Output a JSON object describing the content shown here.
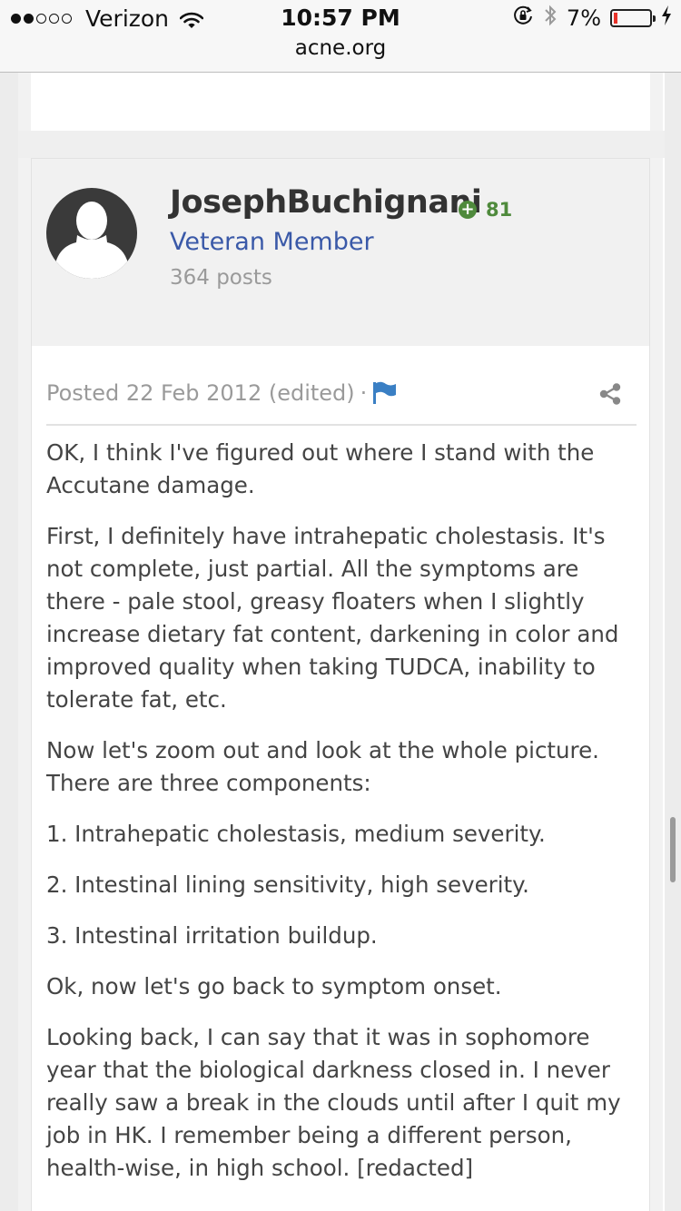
{
  "status_bar": {
    "carrier": "Verizon",
    "time": "10:57 PM",
    "battery": "7%",
    "signal_filled": 2,
    "signal_total": 5
  },
  "browser": {
    "url": "acne.org"
  },
  "post": {
    "author": "JosephBuchignani",
    "reputation": "81",
    "member_title": "Veteran Member",
    "post_count": "364 posts",
    "posted": "Posted 22 Feb 2012 (edited)",
    "meta_separator": "·",
    "paragraphs": [
      "OK, I think I've figured out where I stand with the Accutane damage.",
      "First, I definitely have intrahepatic cholestasis. It's not complete, just partial. All the symptoms are there - pale stool, greasy floaters when I slightly increase dietary fat content, darkening in color and improved quality when taking TUDCA, inability to tolerate fat, etc.",
      "Now let's zoom out and look at the whole picture. There are three components:",
      "1. Intrahepatic cholestasis, medium severity.",
      "2. Intestinal lining sensitivity, high severity.",
      "3. Intestinal irritation buildup.",
      "Ok, now let's go back to symptom onset.",
      "Looking back, I can say that it was in sophomore year that the biological darkness closed in. I never really saw a break in the clouds until after I quit my job in HK. I remember being a different person, health-wise, in high school. [redacted]"
    ]
  },
  "colors": {
    "member_title": "#3a59a8",
    "reputation": "#4f8a3c",
    "flag": "#3a7fc4",
    "battery_low": "#e8332a"
  },
  "icons": {
    "wifi": "wifi-icon",
    "orientation_lock": "orientation-lock-icon",
    "bluetooth": "bluetooth-icon",
    "battery": "battery-icon",
    "charging": "charging-bolt-icon",
    "flag": "flag-icon",
    "share": "share-icon",
    "avatar": "default-avatar-icon",
    "reputation": "plus-circle-icon"
  }
}
